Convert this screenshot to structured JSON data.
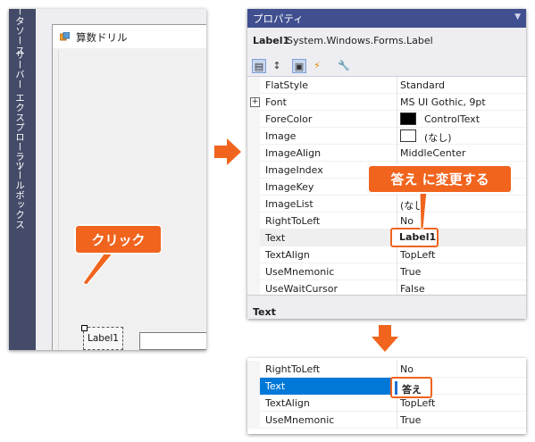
{
  "designer": {
    "side_tabs": [
      "データソース",
      "サーバー エクスプローラー",
      "ツールボックス"
    ],
    "form_title": "算数ドリル",
    "label_text": "Label1",
    "click_callout": "クリック"
  },
  "properties": {
    "panel_title": "プロパティ",
    "object_name": "Label1",
    "object_type": "System.Windows.Forms.Label",
    "rows": [
      {
        "name": "FlatStyle",
        "value": "Standard"
      },
      {
        "name": "Font",
        "value": "MS UI Gothic, 9pt"
      },
      {
        "name": "ForeColor",
        "value": "ControlText",
        "swatch": "#000000"
      },
      {
        "name": "Image",
        "value": "(なし)",
        "swatch": "#ffffff"
      },
      {
        "name": "ImageAlign",
        "value": "MiddleCenter"
      },
      {
        "name": "ImageIndex",
        "value": ""
      },
      {
        "name": "ImageKey",
        "value": ""
      },
      {
        "name": "ImageList",
        "value": "(なし"
      },
      {
        "name": "RightToLeft",
        "value": "No"
      },
      {
        "name": "Text",
        "value": "Label1"
      },
      {
        "name": "TextAlign",
        "value": "TopLeft"
      },
      {
        "name": "UseMnemonic",
        "value": "True"
      },
      {
        "name": "UseWaitCursor",
        "value": "False"
      }
    ],
    "description_title": "Text",
    "change_callout": "答え に変更する"
  },
  "result": {
    "rows": [
      {
        "name": "RightToLeft",
        "value": "No"
      },
      {
        "name": "Text",
        "value": "答え"
      },
      {
        "name": "TextAlign",
        "value": "TopLeft"
      },
      {
        "name": "UseMnemonic",
        "value": "True"
      }
    ]
  },
  "colors": {
    "accent": "#f0641e",
    "panel_title_bg": "#3f4f8f",
    "selection": "#0078d7"
  }
}
